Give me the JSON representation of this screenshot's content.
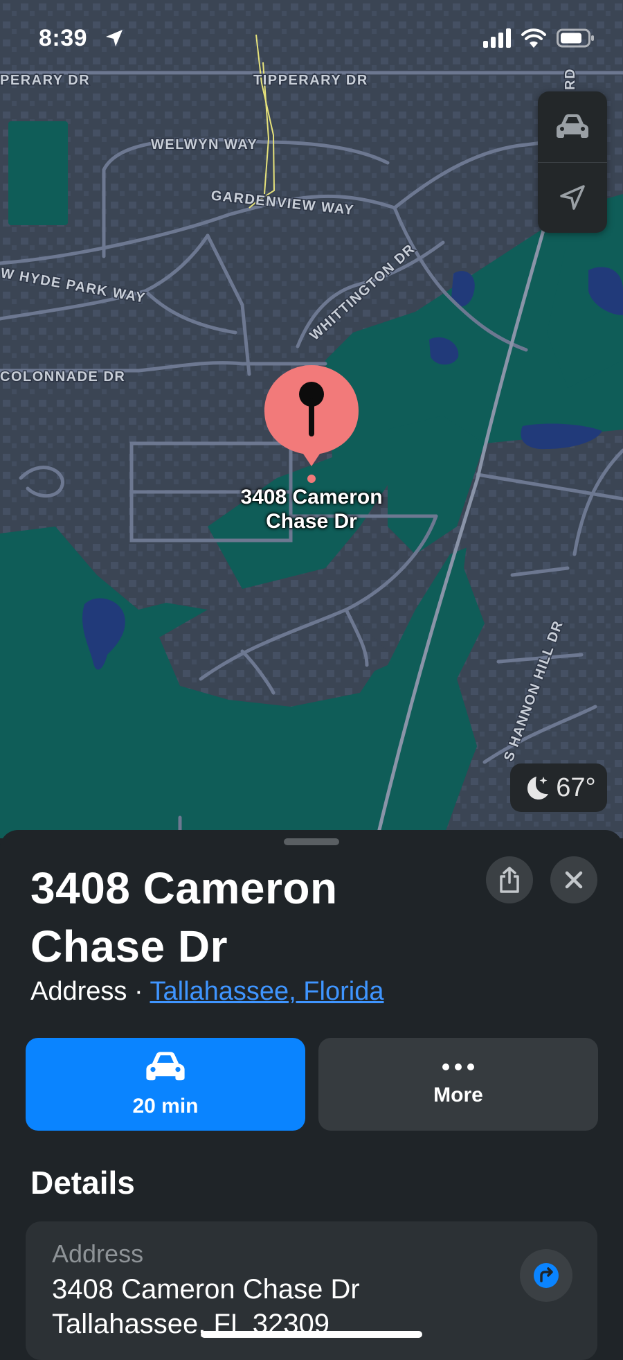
{
  "status_bar": {
    "time": "8:39"
  },
  "map": {
    "street_labels": {
      "tipperary_left": "PERARY DR",
      "tipperary": "TIPPERARY DR",
      "welwyn": "WELWYN WAY",
      "gardenview": "GARDENVIEW WAY",
      "whittington": "WHITTINGTON DR",
      "hyde_park": "W HYDE PARK WAY",
      "colonnade": "COLONNADE DR",
      "hannon_hill": "S HANNON HILL DR",
      "rd_corner": "RD"
    },
    "pin_label": "3408 Cameron\nChase Dr",
    "weather": "67°"
  },
  "colors": {
    "land": "#3b4554",
    "park": "#0f5d58",
    "water": "#213a7a",
    "pin": "#f27a7a",
    "accent": "#0a84ff"
  },
  "sheet": {
    "title": "3408 Cameron Chase Dr",
    "type": "Address",
    "separator": " · ",
    "location_link": "Tallahassee, Florida",
    "actions": [
      {
        "icon": "car-icon",
        "label": "20 min"
      },
      {
        "icon": "more-dots-icon",
        "label": "More"
      }
    ],
    "details_heading": "Details",
    "address_card": {
      "label": "Address",
      "line1": "3408 Cameron Chase Dr",
      "line2": "Tallahassee, FL 32309"
    }
  }
}
